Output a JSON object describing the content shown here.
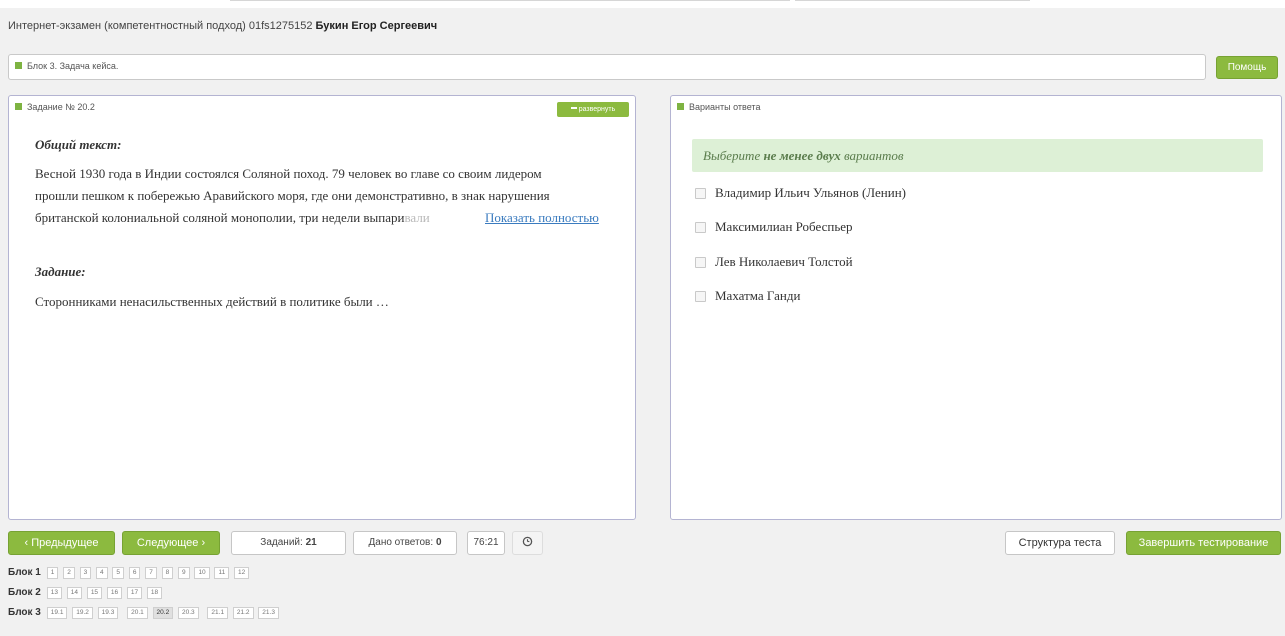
{
  "header": {
    "exam_title": "Интернет-экзамен (компетентностный подход) 01fs1275152",
    "student_name": "Букин Егор Сергеевич"
  },
  "block_bar": {
    "label": "Блок 3. Задача кейса."
  },
  "help_button": "Помощь",
  "task_panel": {
    "title": "Задание № 20.2",
    "expand_label": "развернуть",
    "common_text_title": "Общий текст:",
    "common_text_lines": [
      "Весной 1930 года в Индии состоялся Соляной поход. 79 человек во главе со своим лидером",
      "прошли пешком к побережью Аравийского моря, где они демонстративно, в знак нарушения",
      "британской колониальной соляной монополии, три недели выпари"
    ],
    "common_text_faded": "вали",
    "show_full_link": "Показать полностью",
    "task_title": "Задание:",
    "task_text": "Сторонниками ненасильственных действий в политике были …"
  },
  "answers_panel": {
    "title": "Варианты ответа",
    "hint_prefix": "Выберите ",
    "hint_emphasis": "не менее двух",
    "hint_suffix": " вариантов",
    "options": [
      {
        "label": "Владимир Ильич Ульянов (Ленин)",
        "checked": false
      },
      {
        "label": "Максимилиан Робеспьер",
        "checked": false
      },
      {
        "label": "Лев Николаевич Толстой",
        "checked": false
      },
      {
        "label": "Махатма Ганди",
        "checked": false
      }
    ]
  },
  "bottom_bar": {
    "prev_label": "Предыдущее",
    "next_label": "Следующее",
    "tasks_label": "Заданий:",
    "tasks_count": "21",
    "answers_label": "Дано ответов:",
    "answers_count": "0",
    "timer": "76:21",
    "structure_label": "Структура теста",
    "finish_label": "Завершить тестирование"
  },
  "navigator": {
    "blocks": [
      {
        "label": "Блок 1",
        "items": [
          "1",
          "2",
          "3",
          "4",
          "5",
          "6",
          "7",
          "8",
          "9",
          "10",
          "11",
          "12"
        ]
      },
      {
        "label": "Блок 2",
        "items": [
          "13",
          "14",
          "15",
          "16",
          "17",
          "18"
        ]
      },
      {
        "label": "Блок 3",
        "items": [
          "19.1",
          "19.2",
          "19.3",
          "20.1",
          "20.2",
          "20.3",
          "21.1",
          "21.2",
          "21.3"
        ]
      }
    ],
    "current": "20.2"
  },
  "colors": {
    "accent_green": "#8cba3f",
    "hint_bg": "#ddf0d6",
    "link_blue": "#3a7bbf",
    "panel_border": "#b4b4d2"
  }
}
